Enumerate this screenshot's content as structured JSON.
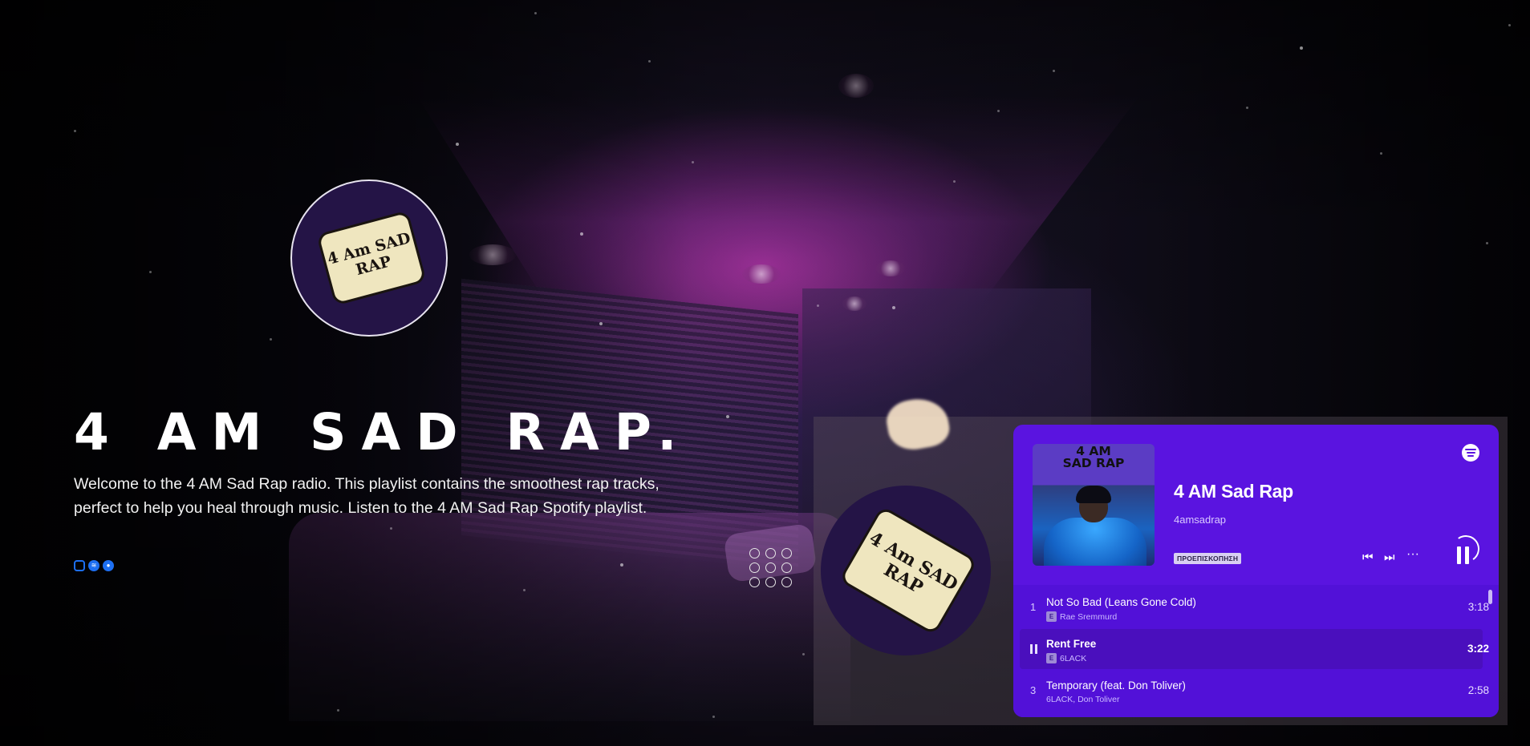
{
  "hero": {
    "title": "4 AM SAD RAP.",
    "description": "Welcome to the 4 AM Sad Rap radio. This playlist contains the smoothest rap tracks, perfect to help you heal through music. Listen to the 4 AM Sad Rap Spotify playlist.",
    "logo_text_line1": "4 Am SAD",
    "logo_text_line2": "RAP",
    "social_icons": [
      "instagram-icon",
      "spotify-icon",
      "reddit-icon"
    ]
  },
  "player": {
    "cover_title_line1": "4 AM",
    "cover_title_line2": "SAD RAP",
    "playlist_title": "4 AM Sad Rap",
    "owner": "4amsadrap",
    "preview_badge": "ΠΡΟΕΠΙΣΚΟΠΗΣΗ",
    "accent_color": "#5a14e0",
    "tracks": [
      {
        "index": "1",
        "name": "Not So Bad (Leans Gone Cold)",
        "artist": "Rae Sremmurd",
        "explicit": "E",
        "duration": "3:18",
        "playing": false
      },
      {
        "index": "2",
        "name": "Rent Free",
        "artist": "6LACK",
        "explicit": "E",
        "duration": "3:22",
        "playing": true
      },
      {
        "index": "3",
        "name": "Temporary (feat. Don Toliver)",
        "artist": "6LACK, Don Toliver",
        "explicit": "",
        "duration": "2:58",
        "playing": false
      }
    ]
  }
}
